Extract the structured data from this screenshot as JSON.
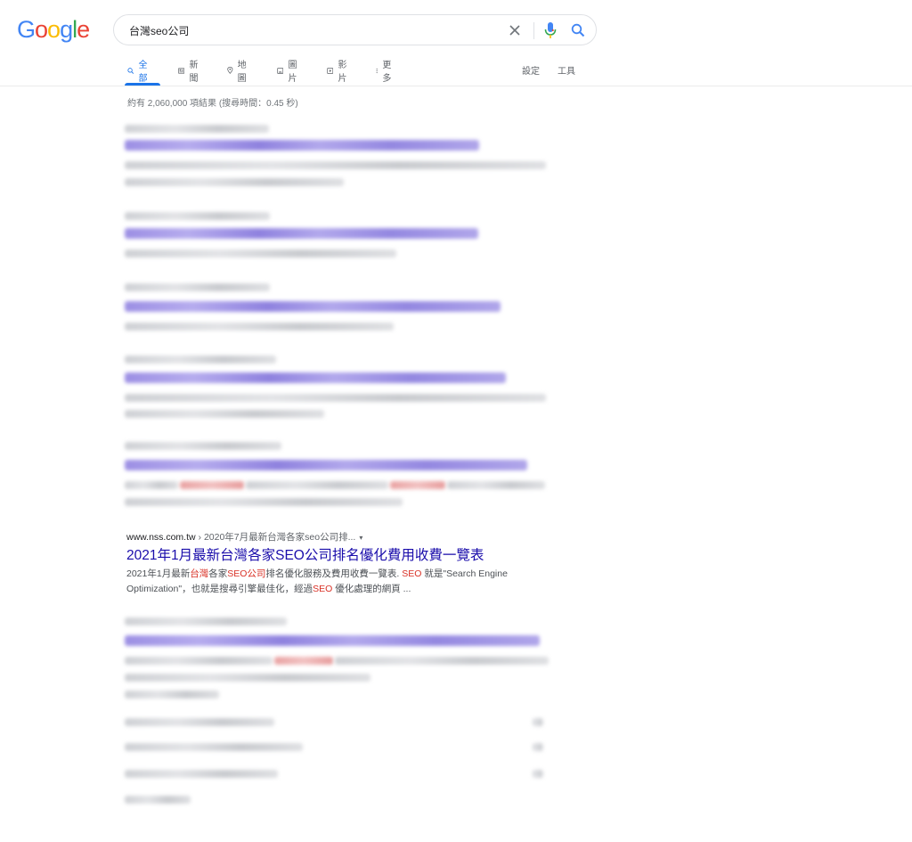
{
  "logo": {
    "letters": [
      "G",
      "o",
      "o",
      "g",
      "l",
      "e"
    ],
    "colors": [
      "#4285f4",
      "#ea4335",
      "#fbbc05",
      "#4285f4",
      "#34a853",
      "#ea4335"
    ]
  },
  "search": {
    "query": "台灣seo公司"
  },
  "tabs": [
    {
      "label": "全部",
      "icon": "search-icon",
      "active": true
    },
    {
      "label": "新聞",
      "icon": "news-icon"
    },
    {
      "label": "地圖",
      "icon": "map-pin-icon"
    },
    {
      "label": "圖片",
      "icon": "image-icon"
    },
    {
      "label": "影片",
      "icon": "video-icon"
    },
    {
      "label": "更多",
      "icon": "more-vert-icon"
    }
  ],
  "tools": {
    "settings": "設定",
    "tools": "工具"
  },
  "stats": "約有 2,060,000 項結果 (搜尋時間：0.45 秒)",
  "result": {
    "domain": "www.nss.com.tw",
    "breadcrumb": " › 2020年7月最新台灣各家seo公司排...",
    "caret": "▾",
    "title": "2021年1月最新台灣各家SEO公司排名優化費用收費一覽表",
    "snippet": [
      {
        "t": "2021年1月最新"
      },
      {
        "t": "台灣",
        "hl": true
      },
      {
        "t": "各家"
      },
      {
        "t": "SEO公司",
        "hl": true
      },
      {
        "t": "排名優化服務及費用收費一覽表. "
      },
      {
        "t": "SEO",
        "hl": true
      },
      {
        "t": " 就是\"Search Engine Optimization\"，也就是搜尋引擎最佳化，經過"
      },
      {
        "t": "SEO",
        "hl": true
      },
      {
        "t": " 優化處理的網頁 ..."
      }
    ]
  },
  "colors": {
    "link": "#1a0dab",
    "accent": "#1a73e8",
    "highlight": "#d93025"
  }
}
